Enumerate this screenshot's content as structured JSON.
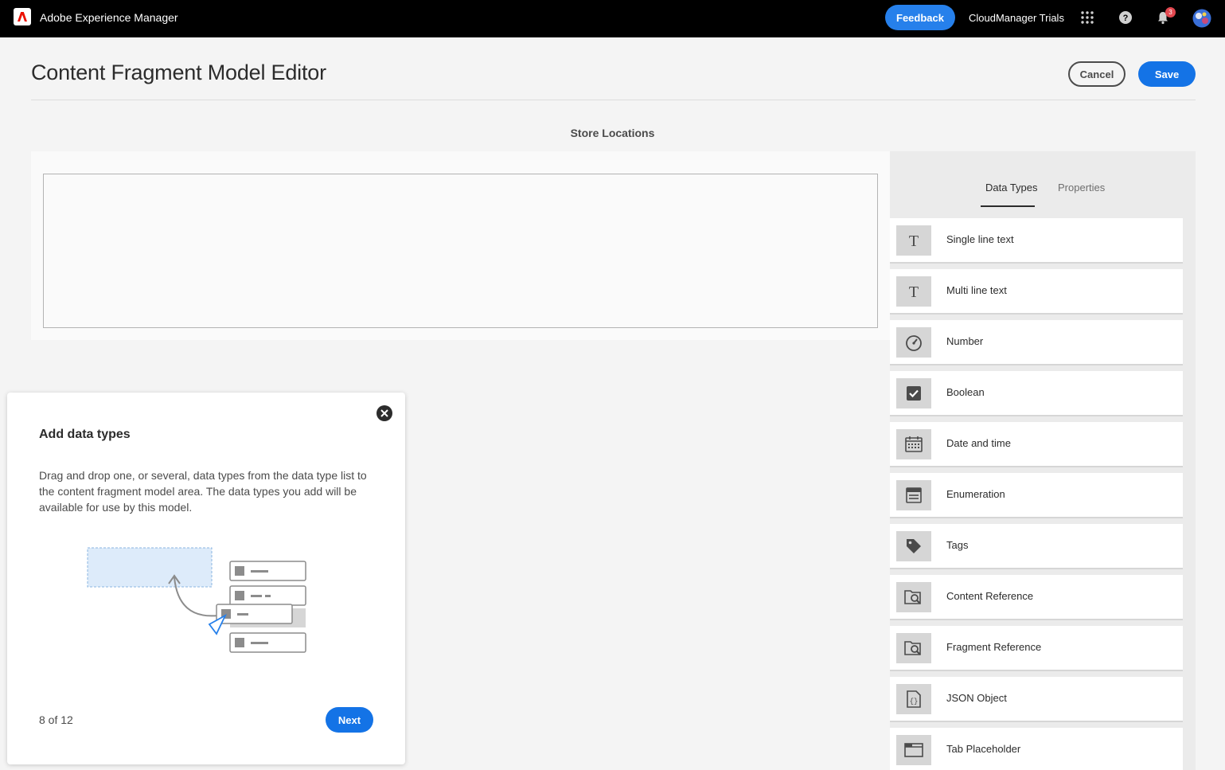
{
  "shell": {
    "app_title": "Adobe Experience Manager",
    "feedback_label": "Feedback",
    "org_name": "CloudManager Trials",
    "notification_count": "3"
  },
  "header": {
    "title": "Content Fragment Model Editor",
    "cancel_label": "Cancel",
    "save_label": "Save"
  },
  "model": {
    "name": "Store Locations"
  },
  "panel": {
    "tabs": [
      {
        "label": "Data Types",
        "active": true
      },
      {
        "label": "Properties",
        "active": false
      }
    ],
    "data_types": [
      {
        "label": "Single line text",
        "icon": "text-icon"
      },
      {
        "label": "Multi line text",
        "icon": "text-icon"
      },
      {
        "label": "Number",
        "icon": "gauge-icon"
      },
      {
        "label": "Boolean",
        "icon": "checkbox-icon"
      },
      {
        "label": "Date and time",
        "icon": "calendar-icon"
      },
      {
        "label": "Enumeration",
        "icon": "list-icon"
      },
      {
        "label": "Tags",
        "icon": "tag-icon"
      },
      {
        "label": "Content Reference",
        "icon": "folder-search-icon"
      },
      {
        "label": "Fragment Reference",
        "icon": "folder-search-icon"
      },
      {
        "label": "JSON Object",
        "icon": "json-file-icon"
      },
      {
        "label": "Tab Placeholder",
        "icon": "tab-window-icon"
      }
    ]
  },
  "coach": {
    "title": "Add data types",
    "body": "Drag and drop one, or several, data types from the data type list to the content fragment model area. The data types you add will be available for use by this model.",
    "step": "8 of 12",
    "next_label": "Next"
  },
  "colors": {
    "accent": "#1473e6",
    "feedback": "#2680eb",
    "badge": "#e34850"
  }
}
